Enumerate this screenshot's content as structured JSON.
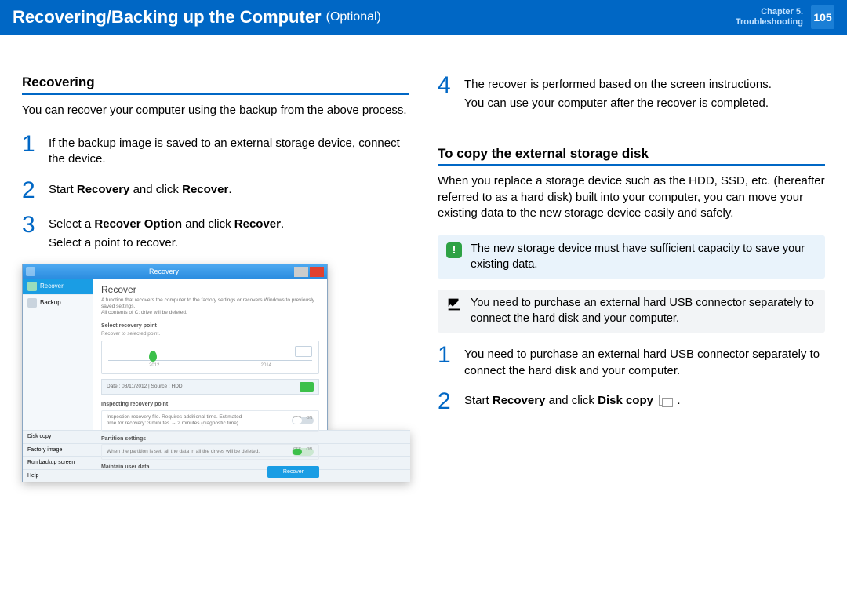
{
  "header": {
    "title": "Recovering/Backing up the Computer",
    "subtitle": "(Optional)",
    "chapter_line1": "Chapter 5.",
    "chapter_line2": "Troubleshooting",
    "page_number": "105"
  },
  "left": {
    "section_title": "Recovering",
    "intro": "You can recover your computer using the backup from the above process.",
    "steps": {
      "1": "If the backup image is saved to an external storage device, connect the device.",
      "2_a": "Start ",
      "2_b": "Recovery",
      "2_c": " and click ",
      "2_d": "Recover",
      "2_e": ".",
      "3_a": "Select a ",
      "3_b": "Recover Option",
      "3_c": " and click ",
      "3_d": "Recover",
      "3_e": ".",
      "3_line2": "Select a point to recover."
    }
  },
  "right": {
    "step4_line1": "The recover is performed based on the screen instructions.",
    "step4_line2": "You can use your computer after the recover is completed.",
    "section_title": "To copy the external storage disk",
    "intro": "When you replace a storage device such as the HDD, SSD, etc. (hereafter referred to as a hard disk) built into your computer, you can move your existing data to the new storage device easily and safely.",
    "note_warn": "The new storage device must have sufficient capacity to save your existing data.",
    "note_info": "You need to purchase an external hard USB connector separately to connect the hard disk and your computer.",
    "steps": {
      "1": "You need to purchase an external hard USB connector separately to connect the hard disk and your computer.",
      "2_a": "Start ",
      "2_b": "Recovery",
      "2_c": " and click ",
      "2_d": "Disk copy",
      "2_e": " ."
    }
  },
  "screenshot": {
    "window_title": "Recovery",
    "side": {
      "recover": "Recover",
      "backup": "Backup",
      "diskcopy": "Disk copy",
      "factory": "Factory image",
      "runbackup": "Run backup screen",
      "help": "Help"
    },
    "main_title": "Recover",
    "main_desc_line1": "A function that recovers the computer to the factory settings or recovers Windows to previously saved settings.",
    "main_desc_line2": "All contents of C: drive will be deleted.",
    "section1_label": "Select recovery point",
    "section1_sub": "Recover to selected point.",
    "year_a": "2012",
    "year_b": "2014",
    "date_label": "Date : 08/11/2012    |    Source : HDD",
    "section2_label": "Inspecting recovery point",
    "opt_inspect": "Inspection recovery file. Requires additional time. Estimated time for recovery: 3 minutes → 2 minutes (diagnostic time)",
    "section3_label": "Partition settings",
    "opt_partition": "When the partition is set, all the data in all the drives will be deleted.",
    "section4_label": "Maintain user data",
    "off": "OFF",
    "on": "ON",
    "recover_btn": "Recover"
  }
}
